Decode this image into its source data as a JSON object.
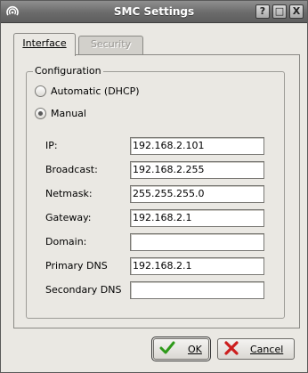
{
  "window": {
    "title": "SMC Settings",
    "help_label": "?",
    "max_label": "□",
    "close_label": "X"
  },
  "tabs": [
    {
      "label": "Interface"
    },
    {
      "label": "Security"
    }
  ],
  "configuration": {
    "legend": "Configuration",
    "options": [
      {
        "label": "Automatic (DHCP)",
        "selected": false
      },
      {
        "label": "Manual",
        "selected": true
      }
    ]
  },
  "fields": [
    {
      "label": "IP:",
      "value": "192.168.2.101"
    },
    {
      "label": "Broadcast:",
      "value": "192.168.2.255"
    },
    {
      "label": "Netmask:",
      "value": "255.255.255.0"
    },
    {
      "label": "Gateway:",
      "value": "192.168.2.1"
    },
    {
      "label": "Domain:",
      "value": ""
    },
    {
      "label": "Primary DNS",
      "value": "192.168.2.1"
    },
    {
      "label": "Secondary DNS",
      "value": ""
    }
  ],
  "buttons": {
    "ok_label": "OK",
    "cancel_label": "Cancel"
  },
  "colors": {
    "ok_check": "#2e9a1a",
    "cancel_x": "#cc1e1e"
  }
}
